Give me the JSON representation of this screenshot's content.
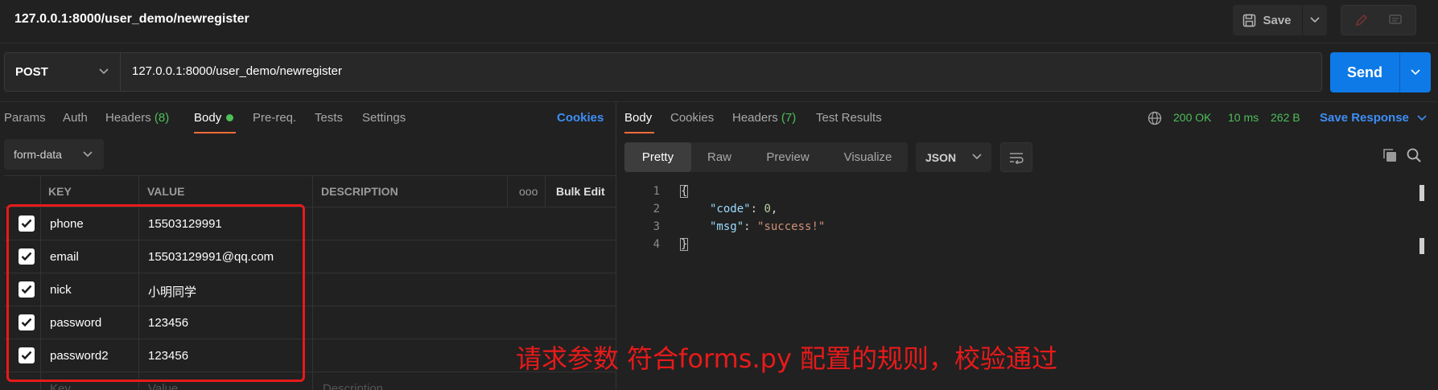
{
  "window": {
    "title": "127.0.0.1:8000/user_demo/newregister",
    "save_label": "Save"
  },
  "request": {
    "method": "POST",
    "url": "127.0.0.1:8000/user_demo/newregister",
    "send_label": "Send"
  },
  "request_tabs": {
    "params": "Params",
    "auth": "Auth",
    "headers": "Headers",
    "headers_count": "(8)",
    "body": "Body",
    "prereq": "Pre-req.",
    "tests": "Tests",
    "settings": "Settings",
    "cookies": "Cookies"
  },
  "body_type": "form-data",
  "params_table": {
    "headers": {
      "key": "KEY",
      "value": "VALUE",
      "description": "DESCRIPTION",
      "more": "ooo",
      "bulk_edit": "Bulk Edit"
    },
    "rows": [
      {
        "key": "phone",
        "value": "15503129991",
        "checked": true
      },
      {
        "key": "email",
        "value": "15503129991@qq.com",
        "checked": true
      },
      {
        "key": "nick",
        "value": "小明同学",
        "checked": true
      },
      {
        "key": "password",
        "value": "123456",
        "checked": true
      },
      {
        "key": "password2",
        "value": "123456",
        "checked": true
      }
    ],
    "placeholders": {
      "key": "Key",
      "value": "Value",
      "description": "Description"
    }
  },
  "response_tabs": {
    "body": "Body",
    "cookies": "Cookies",
    "headers": "Headers",
    "headers_count": "(7)",
    "test_results": "Test Results"
  },
  "response_status": {
    "status": "200 OK",
    "time": "10 ms",
    "size": "262 B",
    "save_response": "Save Response"
  },
  "response_view": {
    "formats": [
      "Pretty",
      "Raw",
      "Preview",
      "Visualize"
    ],
    "active_format": "Pretty",
    "language": "JSON"
  },
  "response_body": {
    "line_numbers": [
      "1",
      "2",
      "3",
      "4"
    ],
    "open_brace": "{",
    "close_brace": "}",
    "code_key": "\"code\"",
    "code_value": "0",
    "msg_key": "\"msg\"",
    "msg_value": "\"success!\""
  },
  "annotation": "请求参数 符合forms.py 配置的规则，校验通过",
  "colors": {
    "accent_orange": "#f26b3a",
    "send_blue": "#0d7ae7",
    "status_green": "#4ebf59",
    "link_blue": "#3e8ef7",
    "annotation_red": "#e81a1a"
  }
}
